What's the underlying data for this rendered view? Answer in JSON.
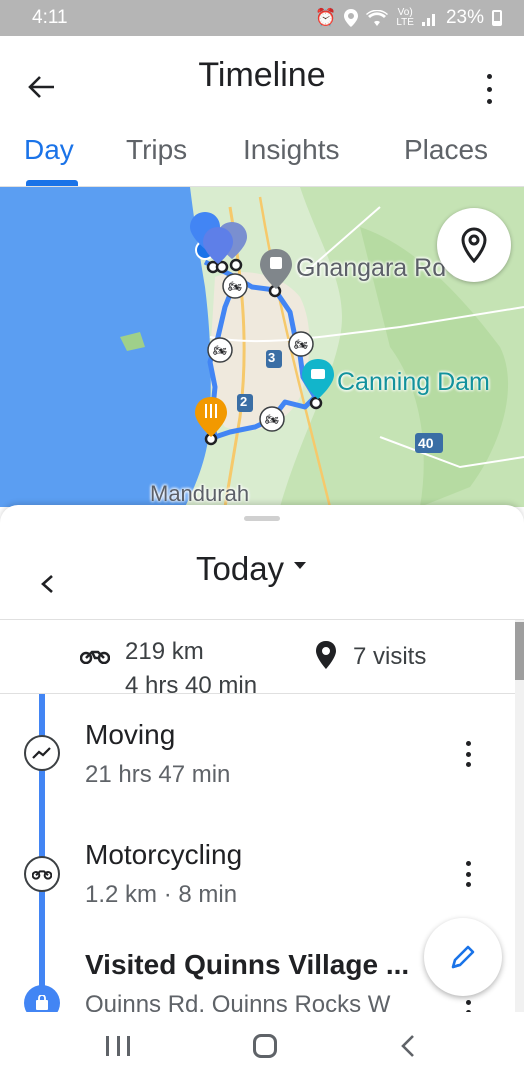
{
  "status_bar": {
    "time": "4:11",
    "signal_label": "Vo)\nLTE",
    "battery": "23%",
    "icons": [
      "alarm-icon",
      "location-icon",
      "wifi-icon",
      "volte-icon",
      "signal-icon",
      "battery-icon"
    ]
  },
  "app_bar": {
    "title": "Timeline",
    "back_icon": "arrow-back-icon",
    "more_icon": "more-vert-icon"
  },
  "tabs": [
    {
      "label": "Day",
      "active": true
    },
    {
      "label": "Trips",
      "active": false
    },
    {
      "label": "Insights",
      "active": false
    },
    {
      "label": "Places",
      "active": false
    }
  ],
  "map": {
    "labels": {
      "gnangara": "Gnangara Rd Bef",
      "canning": "Canning Dam",
      "mandurah": "Mandurah",
      "road_2": "2",
      "road_3": "3",
      "road_40": "40"
    },
    "colors": {
      "route": "#4285f4",
      "sea": "#5b9ef2",
      "land": "#d9eccf",
      "urban": "#efe9dd",
      "restaurant_pin": "#f29900",
      "camera_pin": "#12b5cb",
      "train_pin": "#80868b"
    }
  },
  "sheet": {
    "date_label": "Today",
    "summary": {
      "distance": "219 km",
      "duration": "4 hrs 40 min",
      "visits": "7 visits"
    },
    "items": [
      {
        "title": "Moving",
        "subtitle": "21 hrs 47 min",
        "icon": "moving-icon"
      },
      {
        "title": "Motorcycling",
        "subtitle": "1.2 km · 8 min",
        "icon": "motorcycle-icon"
      },
      {
        "title": "Visited Quinns Village ...",
        "subtitle": "Quinns Rd, Quinns Rocks W",
        "icon": "shopping-bag-icon"
      }
    ],
    "accent": "#1a73e8"
  }
}
